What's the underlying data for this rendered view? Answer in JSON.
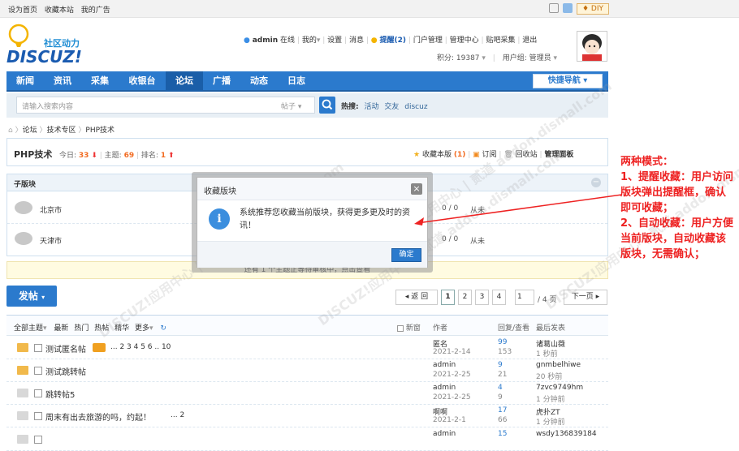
{
  "topbar": {
    "links": [
      "设为首页",
      "收藏本站",
      "我的广告"
    ],
    "diy": "♦ DIY"
  },
  "logo": {
    "slogan": "社区动力",
    "brand": "DISCUZ!"
  },
  "user": {
    "name": "admin",
    "status": "在线",
    "my": "我的",
    "settings": "设置",
    "messages": "消息",
    "remind": "提醒(2)",
    "portal": "门户管理",
    "admin_center": "管理中心",
    "collect": "贴吧采集",
    "logout": "退出",
    "credits": "积分: 19387",
    "group": "用户组: 管理员"
  },
  "nav": {
    "items": [
      "新闻",
      "资讯",
      "采集",
      "收银台",
      "论坛",
      "广播",
      "动态",
      "日志"
    ],
    "active": "论坛",
    "quick": "快捷导航"
  },
  "search": {
    "placeholder": "请输入搜索内容",
    "type": "帖子",
    "hot_label": "热搜:",
    "hot": [
      "活动",
      "交友",
      "discuz"
    ]
  },
  "breadcrumb": [
    "论坛",
    "技术专区",
    "PHP技术"
  ],
  "forum": {
    "name": "PHP技术",
    "today_label": "今日:",
    "today": "33",
    "topics_label": "主题:",
    "topics": "69",
    "rank_label": "排名:",
    "rank": "1",
    "fav_label": "收藏本版",
    "fav_count": "(1)",
    "subscribe": "订阅",
    "recycle": "回收站",
    "manage": "管理面板"
  },
  "subforums": {
    "title": "子版块",
    "items": [
      {
        "name": "北京市",
        "stats": "0 / 0",
        "last": "从未"
      },
      {
        "name": "天津市",
        "stats": "0 / 0",
        "last": "从未"
      }
    ]
  },
  "notice": {
    "text": "还有 1 个主题正等待审核中，点击查看"
  },
  "post_button": "发帖",
  "pager": {
    "back": "◂ 返 回",
    "pages": [
      "1",
      "2",
      "3",
      "4"
    ],
    "current_input": "1",
    "total": "/ 4 页",
    "next": "下一页"
  },
  "thread_filters": {
    "all": "全部主题",
    "items": [
      "最新",
      "热门",
      "热帖",
      "精华",
      "更多"
    ],
    "new_window": "新窗",
    "author": "作者",
    "reply_view": "回复/查看",
    "last_post": "最后发表"
  },
  "threads": [
    {
      "title": "测试匿名帖",
      "pages": "... 2 3 4 5 6 .. 10",
      "author": "匿名",
      "date": "2021-2-14",
      "replies": "99",
      "views": "153",
      "last_user": "诸葛山薇",
      "last_time": "1 秒前",
      "folder": "#f1b94b"
    },
    {
      "title": "测试跳转帖",
      "pages": "",
      "author": "admin",
      "date": "2021-2-25",
      "replies": "9",
      "views": "21",
      "last_user": "gnmbelhiwe",
      "last_time": "20 秒前",
      "folder": "#f1b94b"
    },
    {
      "title": "跳转帖5",
      "pages": "",
      "author": "admin",
      "date": "2021-2-25",
      "replies": "4",
      "views": "9",
      "last_user": "7zvc9749hm",
      "last_time": "1 分钟前",
      "folder": "#d8d8d8"
    },
    {
      "title": "周末有出去旅游的吗，约起！",
      "pages": "... 2",
      "author": "啊啊",
      "date": "2021-2-1",
      "replies": "17",
      "views": "66",
      "last_user": "虎扑ZT",
      "last_time": "1 分钟前",
      "folder": "#d8d8d8"
    },
    {
      "title": "",
      "pages": "",
      "author": "admin",
      "date": "",
      "replies": "15",
      "views": "",
      "last_user": "wsdy136839184",
      "last_time": "",
      "folder": "#d8d8d8"
    }
  ],
  "dialog": {
    "title": "收藏版块",
    "message": "系统推荐您收藏当前版块，获得更多更及时的资讯！",
    "confirm": "确定"
  },
  "annotation": "两种模式：\n1、提醒收藏：用户访问版块弹出提醒框，确认即可收藏；\n2、自动收藏：用户方便当前版块，自动收藏该版块，无需确认；",
  "watermark": "DISCUZ!应用中心 | 贰道 addon.dismall.com",
  "colors": {
    "nav": "#2b7acd",
    "accent_red": "#ee2222",
    "orange": "#f26c22"
  }
}
